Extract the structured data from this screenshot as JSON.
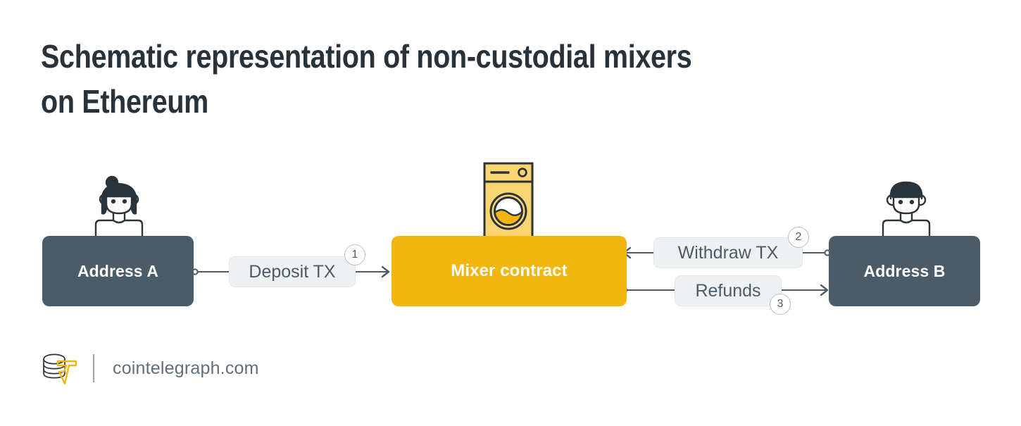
{
  "page": {
    "title": "Schematic representation of non-custodial mixers\non Ethereum",
    "background_color": "#ffffff"
  },
  "colors": {
    "title_text": "#28323a",
    "node_dark": "#4b5c68",
    "node_accent": "#f3b50f",
    "pill_bg": "#eef1f2",
    "pill_border": "#e2e6e8",
    "pill_text": "#4b5c68",
    "line": "#4b5c68",
    "badge_border": "#b7c0c6",
    "footer_text": "#60707b",
    "washer_body": "#fbd570",
    "washer_outline": "#2b333a"
  },
  "diagram": {
    "type": "flow",
    "nodes": [
      {
        "id": "address_a",
        "label": "Address A",
        "kind": "actor",
        "avatar": "female-avatar-icon"
      },
      {
        "id": "mixer",
        "label": "Mixer contract",
        "kind": "contract",
        "icon": "washing-machine-icon"
      },
      {
        "id": "address_b",
        "label": "Address B",
        "kind": "actor",
        "avatar": "male-avatar-icon"
      }
    ],
    "edges": [
      {
        "step": "1",
        "label": "Deposit TX",
        "from": "address_a",
        "to": "mixer",
        "direction": "right"
      },
      {
        "step": "2",
        "label": "Withdraw TX",
        "from": "address_b",
        "to": "mixer",
        "direction": "left"
      },
      {
        "step": "3",
        "label": "Refunds",
        "from": "mixer",
        "to": "address_b",
        "direction": "right"
      }
    ]
  },
  "footer": {
    "site": "cointelegraph.com",
    "logo": "cointelegraph-logo"
  }
}
